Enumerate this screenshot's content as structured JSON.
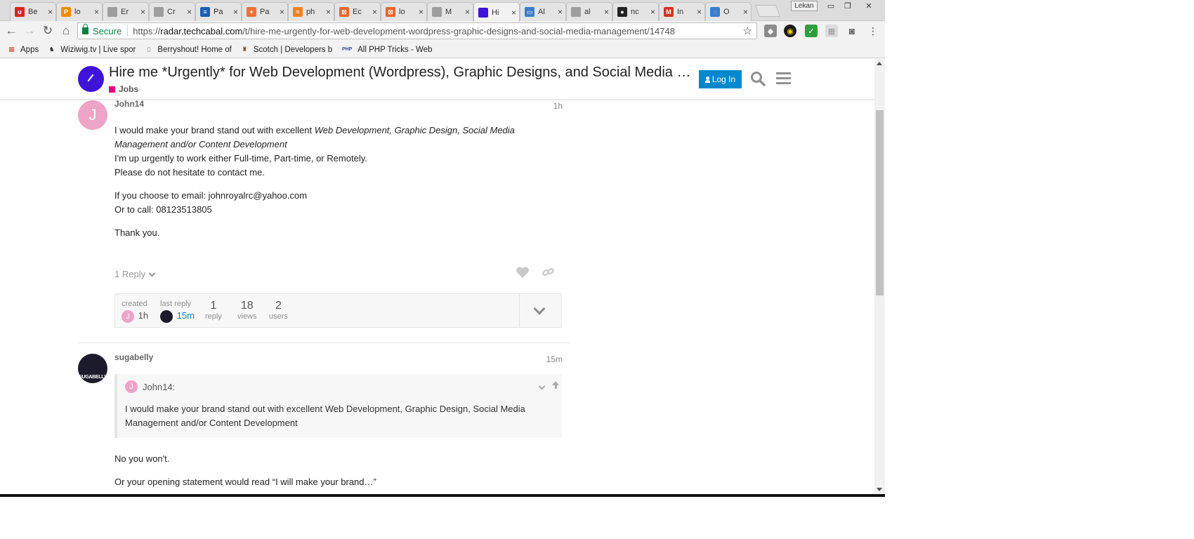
{
  "browser": {
    "tabs": [
      {
        "title": "Be",
        "favicon_text": "u",
        "favicon_color": "#d9261c"
      },
      {
        "title": "lo",
        "favicon_text": "P",
        "favicon_color": "#f28c00"
      },
      {
        "title": "Er",
        "favicon_text": "",
        "favicon_color": "#9e9e9e"
      },
      {
        "title": "Cr",
        "favicon_text": "",
        "favicon_color": "#9e9e9e"
      },
      {
        "title": "Pa",
        "favicon_text": "≡",
        "favicon_color": "#1a5fb4"
      },
      {
        "title": "Pa",
        "favicon_text": "+",
        "favicon_color": "#f0703a"
      },
      {
        "title": "ph",
        "favicon_text": "≈",
        "favicon_color": "#f48024"
      },
      {
        "title": "Ec",
        "favicon_text": "⊠",
        "favicon_color": "#e8652a"
      },
      {
        "title": "lo",
        "favicon_text": "⊠",
        "favicon_color": "#e8652a"
      },
      {
        "title": "M",
        "favicon_text": "",
        "favicon_color": "#9e9e9e"
      },
      {
        "title": "Hi",
        "favicon_text": "",
        "favicon_color": "#3f14d8",
        "active": true
      },
      {
        "title": "Al",
        "favicon_text": "▭",
        "favicon_color": "#3b7dc9"
      },
      {
        "title": "al",
        "favicon_text": "",
        "favicon_color": "#9e9e9e"
      },
      {
        "title": "nc",
        "favicon_text": "●",
        "favicon_color": "#222222"
      },
      {
        "title": "In",
        "favicon_text": "M",
        "favicon_color": "#d93025"
      },
      {
        "title": "O",
        "favicon_text": "◌",
        "favicon_color": "#3b7dc9"
      }
    ],
    "profile": "Lekan",
    "secure_label": "Secure",
    "url_scheme": "https://",
    "url_host": "radar.techcabal.com",
    "url_path": "/t/hire-me-urgently-for-web-development-wordpress-graphic-designs-and-social-media-management/14748",
    "bookmarks": [
      {
        "label": "Apps",
        "icon": "apps-grid-icon"
      },
      {
        "label": "Wiziwig.tv | Live spor",
        "icon": "wiziwig-icon"
      },
      {
        "label": "Berryshout! Home of",
        "icon": "page-icon"
      },
      {
        "label": "Scotch | Developers b",
        "icon": "scotch-icon"
      },
      {
        "label": "All PHP Tricks - Web",
        "icon": "php-icon"
      }
    ]
  },
  "site": {
    "topic_title": "Hire me *Urgently* for Web Development (Wordpress), Graphic Designs, and Social Media Management",
    "category": "Jobs",
    "category_color": "#e5007d",
    "login_label": "Log In",
    "brand_color": "#3f14d8",
    "accent_color": "#0088cc"
  },
  "post1": {
    "avatar_letter": "J",
    "username": "John14",
    "date": "1h",
    "para1_pre": "I would make your brand stand out with excellent ",
    "para1_em": "Web Development, Graphic Design, Social Media Management and/or Content Development",
    "line2": "I'm up urgently to work either Full-time, Part-time, or Remotely.",
    "line3": "Please do not hesitate to contact me.",
    "email_line": "If you choose to email: johnroyalrc@yahoo.com",
    "call_line": "Or to call: 08123513805",
    "thanks": "Thank you.",
    "reply_toggle": "1 Reply"
  },
  "topic_map": {
    "created_label": "created",
    "created_avatar": "J",
    "created_value": "1h",
    "last_reply_label": "last reply",
    "last_reply_value": "15m",
    "reply_count": "1",
    "reply_label": "reply",
    "views_count": "18",
    "views_label": "views",
    "users_count": "2",
    "users_label": "users"
  },
  "post2": {
    "username": "sugabelly",
    "avatar_text": "SUGABELLY",
    "date": "15m",
    "quote_author": "John14:",
    "quote_avatar": "J",
    "quote_text": "I would make your brand stand out with excellent Web Development, Graphic Design, Social Media Management and/or Content Development",
    "line1": "No you won't.",
    "line2": "Or your opening statement would read “I will make your brand…”"
  }
}
